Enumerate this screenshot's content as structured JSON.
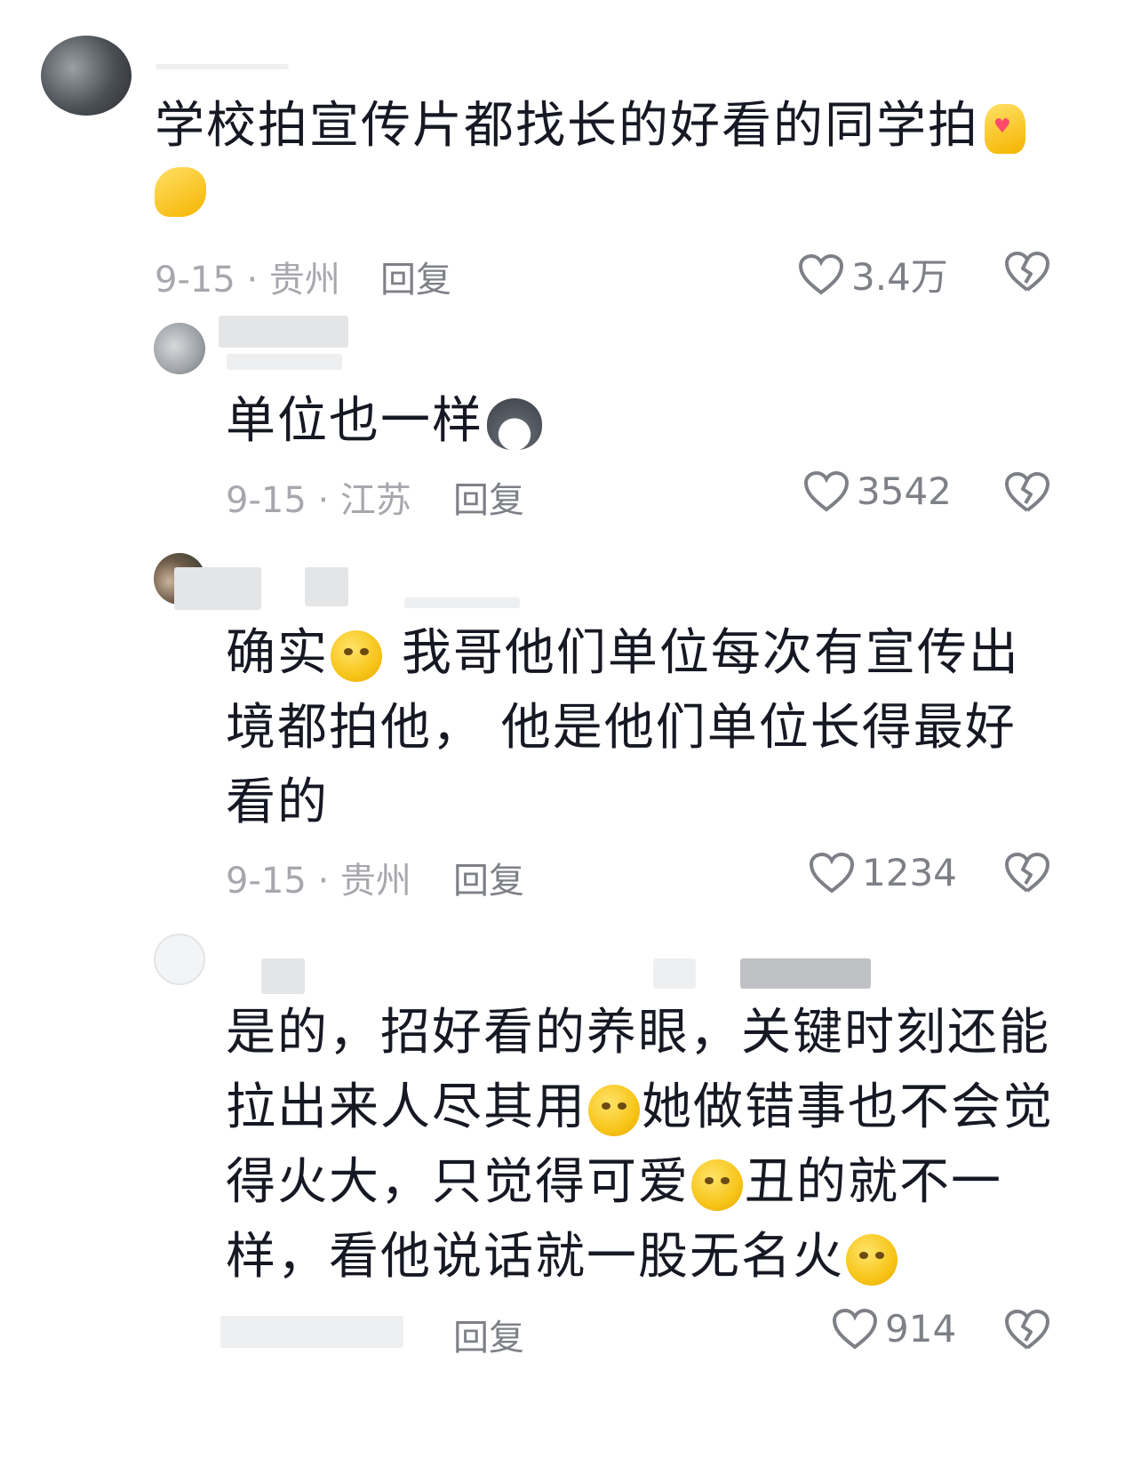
{
  "comments": [
    {
      "text": "学校拍宣传片都找长的好看的同学拍",
      "date_location": "9-15 · 贵州",
      "reply_label": "回复",
      "like_count": "3.4万",
      "emoji": [
        "hand-heart-icon",
        "flexed-biceps-icon"
      ]
    },
    {
      "text": "单位也一样",
      "date_location": "9-15 · 江苏",
      "reply_label": "回复",
      "like_count": "3542",
      "emoji": [
        "dog-face-icon"
      ]
    },
    {
      "text_a": "确实",
      "text_b": "我哥他们单位每次有宣传出境都拍他， 他是他们单位长得最好看的",
      "date_location": "9-15 · 贵州",
      "reply_label": "回复",
      "like_count": "1234",
      "emoji": [
        "crying-face-icon"
      ]
    },
    {
      "text_a": "是的，招好看的养眼，关键时刻还能拉出来人尽其用",
      "text_b": "她做错事也不会觉得火大，只觉得可爱",
      "text_c": "丑的就不一样，看他说话就一股无名火",
      "reply_label": "回复",
      "like_count": "914",
      "emoji": [
        "laughing-crying-icon",
        "laughing-crying-icon",
        "woozy-face-icon"
      ]
    }
  ]
}
